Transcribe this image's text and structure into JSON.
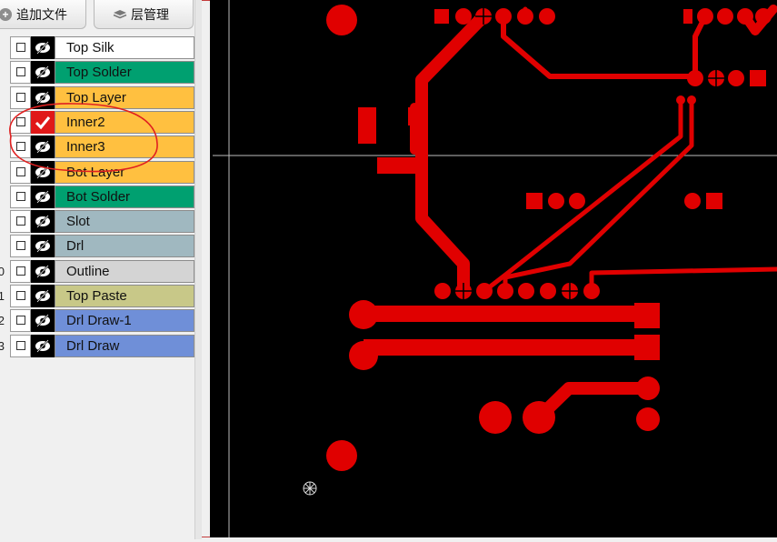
{
  "toolbar": {
    "add_file_label": "追加文件",
    "layer_manage_label": "层管理"
  },
  "layers": [
    {
      "num": "",
      "name": "Top Silk",
      "color": "#ffffff",
      "checked": false
    },
    {
      "num": "",
      "name": "Top Solder",
      "color": "#00a070",
      "checked": false
    },
    {
      "num": "",
      "name": "Top Layer",
      "color": "#ffc040",
      "checked": false
    },
    {
      "num": "",
      "name": "Inner2",
      "color": "#ffc040",
      "checked": true
    },
    {
      "num": "",
      "name": "Inner3",
      "color": "#ffc040",
      "checked": false
    },
    {
      "num": "",
      "name": "Bot Layer",
      "color": "#ffc040",
      "checked": false
    },
    {
      "num": "",
      "name": "Bot Solder",
      "color": "#00a070",
      "checked": false
    },
    {
      "num": "",
      "name": "Slot",
      "color": "#a0b8c0",
      "checked": false
    },
    {
      "num": "",
      "name": "Drl",
      "color": "#a0b8c0",
      "checked": false
    },
    {
      "num": "0",
      "name": "Outline",
      "color": "#d4d4d4",
      "checked": false
    },
    {
      "num": "1",
      "name": "Top Paste",
      "color": "#c8c888",
      "checked": false
    },
    {
      "num": "2",
      "name": "Drl Draw-1",
      "color": "#6f8fd8",
      "checked": false
    },
    {
      "num": "3",
      "name": "Drl Draw",
      "color": "#6f8fd8",
      "checked": false
    }
  ],
  "colors": {
    "copper": "#e00000",
    "canvas_bg": "#000000",
    "annotation": "#e02020"
  },
  "icons": {
    "add": "plus-circle-icon",
    "layers": "layers-icon",
    "eye": "eye-icon",
    "crosshair": "crosshair-cursor-icon"
  }
}
